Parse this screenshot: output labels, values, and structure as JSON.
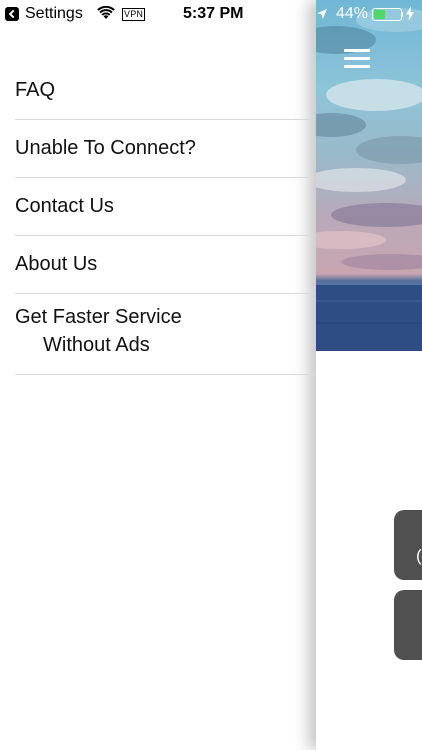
{
  "status_bar": {
    "back_label": "Settings",
    "vpn_label": "VPN",
    "time": "5:37 PM",
    "battery_percent": "44%",
    "battery_level": 0.44,
    "icons": [
      "back-arrow-icon",
      "wifi-icon",
      "location-arrow-icon",
      "battery-icon",
      "charging-bolt-icon"
    ]
  },
  "drawer": {
    "items": [
      {
        "label": "FAQ"
      },
      {
        "label": "Unable To Connect?"
      },
      {
        "label": "Contact Us"
      },
      {
        "label": "About Us"
      },
      {
        "label_line1": "Get Faster Service",
        "label_line2": "Without Ads"
      }
    ]
  },
  "main": {
    "menu_icon": "hamburger-menu-icon",
    "button_fragment": "("
  },
  "colors": {
    "drawer_background": "#ffffff",
    "divider": "#d9d9d9",
    "button_dark": "#505050",
    "battery_green": "#4cd964"
  }
}
